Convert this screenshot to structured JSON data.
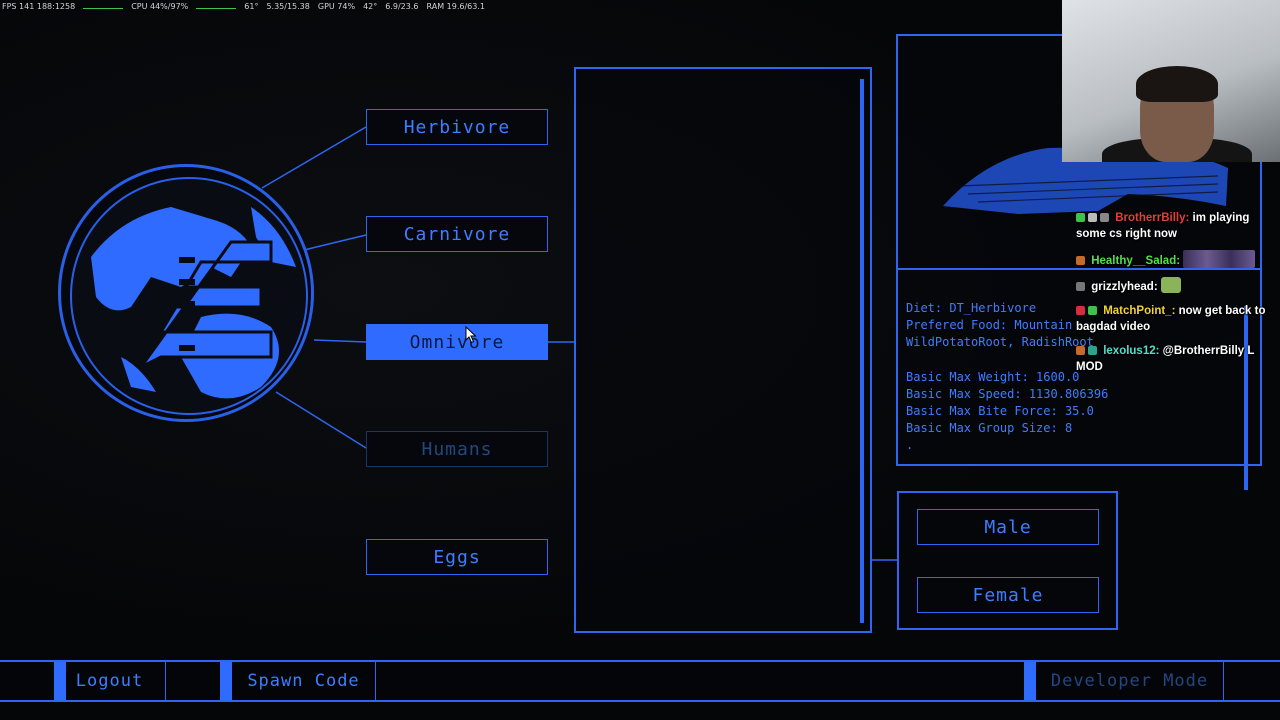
{
  "perf": {
    "fps": "FPS 141 188:1258",
    "cpu": "CPU 44%/97%",
    "temp": "61°",
    "mem": "5.35/15.38",
    "gpu": "GPU 74%",
    "gpu_temp": "42°",
    "vram": "6.9/23.6",
    "ram": "RAM 19.6/63.1"
  },
  "categories": [
    {
      "label": "Herbivore",
      "state": "normal"
    },
    {
      "label": "Carnivore",
      "state": "normal"
    },
    {
      "label": "Omnivore",
      "state": "active"
    },
    {
      "label": "Humans",
      "state": "disabled"
    },
    {
      "label": "Eggs",
      "state": "normal"
    }
  ],
  "info": {
    "diet": "Diet: DT_Herbivore",
    "food_1": "Prefered Food: Mountain",
    "food_2": "WildPotatoRoot, RadishRoot",
    "weight": "Basic Max Weight: 1600.0",
    "speed": "Basic Max Speed: 1130.806396",
    "bite": "Basic Max Bite Force: 35.0",
    "group": "Basic Max Group Size: 8",
    "dot": "."
  },
  "gender": {
    "male": "Male",
    "female": "Female"
  },
  "bottom": {
    "logout": "Logout",
    "spawn_code": "Spawn Code",
    "developer_mode": "Developer Mode"
  },
  "chat": [
    {
      "user": "BrotherrBilly:",
      "color": "#e0403a",
      "text": "im playing some cs right now"
    },
    {
      "user": "Healthy__Salad:",
      "color": "#53e04a",
      "text": ""
    },
    {
      "user": "grizzlyhead:",
      "color": "#ffffff",
      "text": ""
    },
    {
      "user": "MatchPoint_:",
      "color": "#f2d33a",
      "text": "now get back to bagdad video"
    },
    {
      "user": "lexolus12:",
      "color": "#4fe0c8",
      "text": "@BrotherrBilly L MOD"
    }
  ],
  "colors": {
    "accent": "#2f6bff",
    "border": "#2d66f0",
    "bg": "#050608"
  }
}
